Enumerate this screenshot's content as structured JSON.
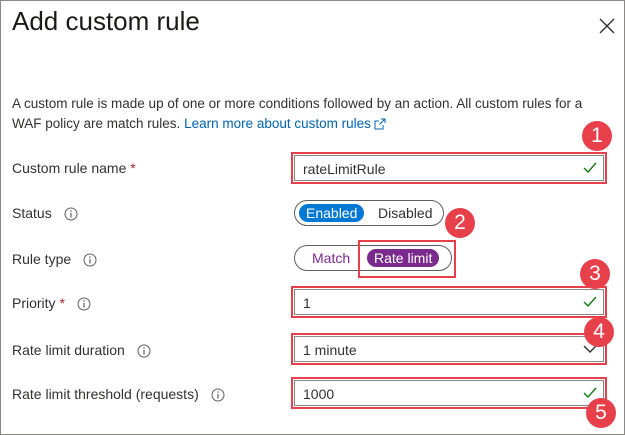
{
  "panel": {
    "title": "Add custom rule",
    "close_icon": "close-icon",
    "description": "A custom rule is made up of one or more conditions followed by an action. All custom rules for a WAF policy are match rules.",
    "learn_more_link": "Learn more about custom rules"
  },
  "form": {
    "rule_name": {
      "label": "Custom rule name",
      "required_mark": "*",
      "value": "rateLimitRule"
    },
    "status": {
      "label": "Status",
      "options": [
        "Enabled",
        "Disabled"
      ],
      "selected": "Enabled"
    },
    "rule_type": {
      "label": "Rule type",
      "options": [
        "Match",
        "Rate limit"
      ],
      "selected": "Rate limit"
    },
    "priority": {
      "label": "Priority",
      "required_mark": "*",
      "value": "1"
    },
    "rate_limit_duration": {
      "label": "Rate limit duration",
      "value": "1 minute"
    },
    "rate_limit_threshold": {
      "label": "Rate limit threshold (requests)",
      "value": "1000"
    }
  },
  "callouts": [
    "1",
    "2",
    "3",
    "4",
    "5"
  ],
  "colors": {
    "accent_blue": "#0078d4",
    "accent_purple": "#7a2a8d",
    "callout_red": "#e8404b",
    "check_green": "#107c10"
  }
}
